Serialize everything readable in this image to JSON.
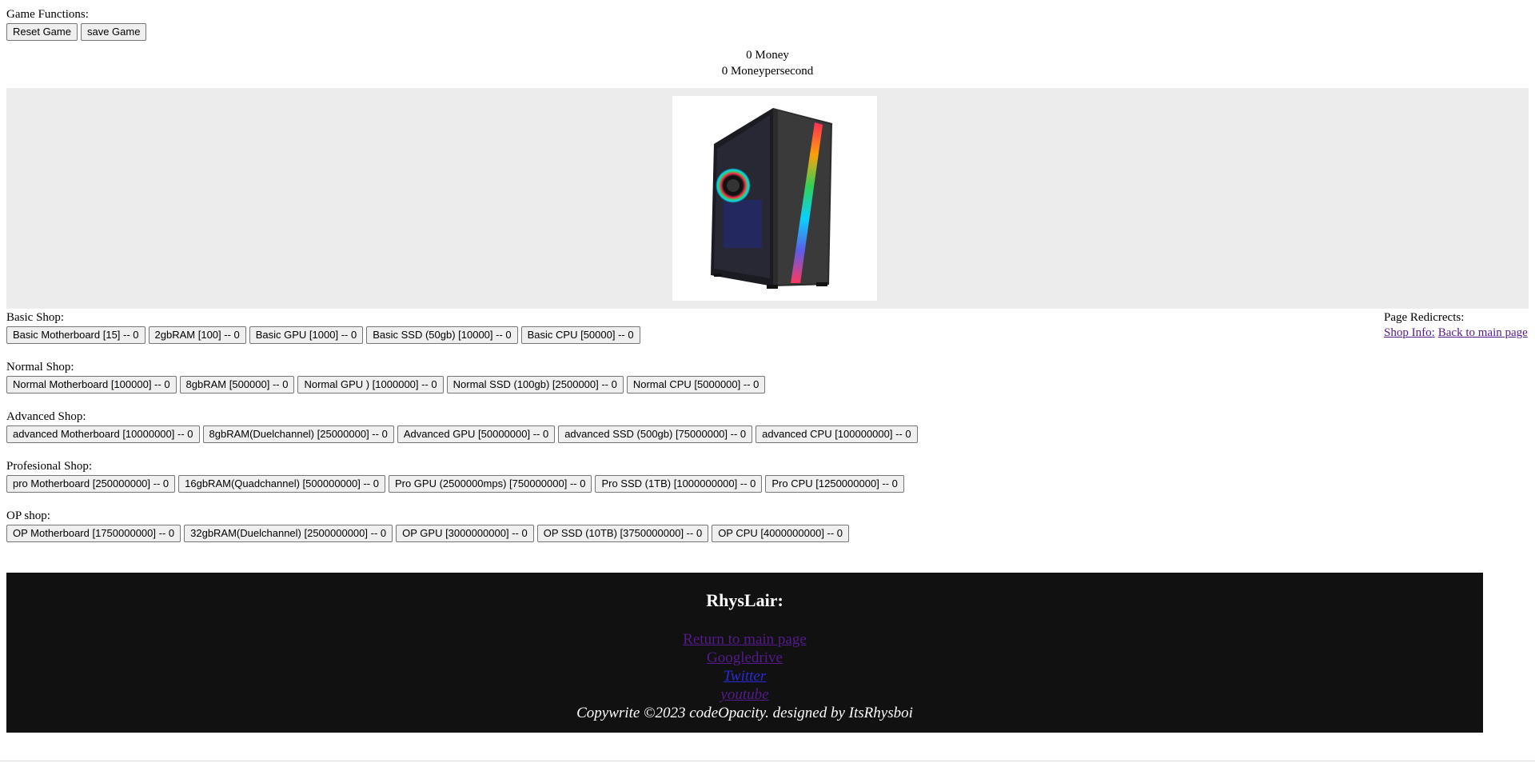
{
  "functions": {
    "label": "Game Functions:",
    "reset_label": "Reset Game",
    "save_label": "save Game"
  },
  "stats": {
    "money": "0 Money",
    "money_per_second": "0 Moneypersecond"
  },
  "shops": [
    {
      "label": "Basic Shop:",
      "items": [
        "Basic Motherboard [15] -- 0",
        "2gbRAM [100] -- 0",
        "Basic GPU [1000] -- 0",
        "Basic SSD (50gb) [10000] -- 0",
        "Basic CPU [50000] -- 0"
      ]
    },
    {
      "label": "Normal Shop:",
      "items": [
        "Normal Motherboard [100000] -- 0",
        "8gbRAM [500000] -- 0",
        "Normal GPU ) [1000000] -- 0",
        "Normal SSD (100gb) [2500000] -- 0",
        "Normal CPU [5000000] -- 0"
      ]
    },
    {
      "label": "Advanced Shop:",
      "items": [
        "advanced Motherboard [10000000] -- 0",
        "8gbRAM(Duelchannel) [25000000] -- 0",
        "Advanced GPU [50000000] -- 0",
        "advanced SSD (500gb) [75000000] -- 0",
        "advanced CPU [100000000] -- 0"
      ]
    },
    {
      "label": "Profesional Shop:",
      "items": [
        "pro Motherboard [250000000] -- 0",
        "16gbRAM(Quadchannel) [500000000] -- 0",
        "Pro GPU (2500000mps) [750000000] -- 0",
        "Pro SSD (1TB) [1000000000] -- 0",
        "Pro CPU [1250000000] -- 0"
      ]
    },
    {
      "label": "OP shop:",
      "items": [
        "OP Motherboard [1750000000] -- 0",
        "32gbRAM(Duelchannel) [2500000000] -- 0",
        "OP GPU [3000000000] -- 0",
        "OP SSD (10TB) [3750000000] -- 0",
        "OP CPU [4000000000] -- 0"
      ]
    }
  ],
  "redirects": {
    "label": "Page Redicrects:",
    "shop_info": "Shop Info:",
    "back": "Back to main page"
  },
  "footer": {
    "title": "RhysLair:",
    "return_link": "Return to main page",
    "googledrive": "Googledrive",
    "twitter": "Twitter",
    "youtube": "youtube",
    "copyright": "Copywrite ©2023 codeOpacity. designed by ItsRhysboi"
  }
}
